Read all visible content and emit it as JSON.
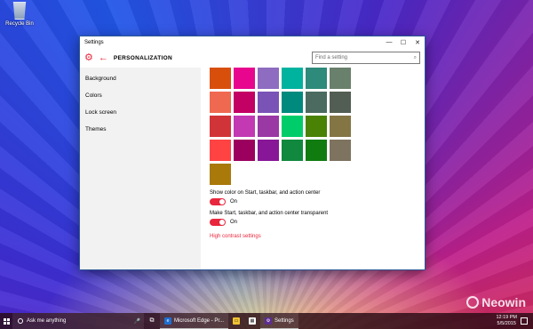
{
  "desktop": {
    "recycle_bin_label": "Recycle Bin"
  },
  "window": {
    "title": "Settings",
    "controls": {
      "minimize": "—",
      "maximize": "☐",
      "close": "✕"
    },
    "header": {
      "page_title": "PERSONALIZATION",
      "gear_icon": "⚙",
      "back_icon": "←",
      "search_placeholder": "Find a setting",
      "search_icon": "⌕"
    },
    "nav": {
      "items": [
        {
          "label": "Background"
        },
        {
          "label": "Colors"
        },
        {
          "label": "Lock screen"
        },
        {
          "label": "Themes"
        }
      ]
    },
    "content": {
      "swatches": [
        "#d84f0c",
        "#e8068f",
        "#8e6cc0",
        "#00b39f",
        "#2e8a7b",
        "#69806c",
        "#ef6950",
        "#c30063",
        "#7a53b6",
        "#008a7e",
        "#4c6b60",
        "#525e54",
        "#d13438",
        "#c239b3",
        "#9a38a4",
        "#00cc6a",
        "#498205",
        "#847545",
        "#ff4343",
        "#9c005e",
        "#881798",
        "#10893e",
        "#107c10",
        "#7e735f",
        "#a9790a"
      ],
      "show_color_label": "Show color on Start, taskbar, and action center",
      "show_color_state": "On",
      "transparent_label": "Make Start, taskbar, and action center transparent",
      "transparent_state": "On",
      "high_contrast_link": "High contrast settings"
    },
    "accent_color": "#e8263c"
  },
  "taskbar": {
    "search_placeholder": "Ask me anything",
    "mic_icon": "🎤",
    "task_view_icon": "⧉",
    "apps": [
      {
        "name": "Microsoft Edge - Pr...",
        "glyph": "e",
        "color": "#1f6fcf"
      },
      {
        "name": "Settings",
        "glyph": "⚙",
        "color": "#5c2d91"
      }
    ],
    "pinned": [
      {
        "name": "file-explorer",
        "glyph": "▭",
        "color": "#f1c232"
      },
      {
        "name": "store",
        "glyph": "▦",
        "color": "#ffffff"
      }
    ],
    "clock_time": "12:19 PM",
    "clock_date": "5/5/2015"
  },
  "watermark": {
    "text": "Neowin"
  }
}
